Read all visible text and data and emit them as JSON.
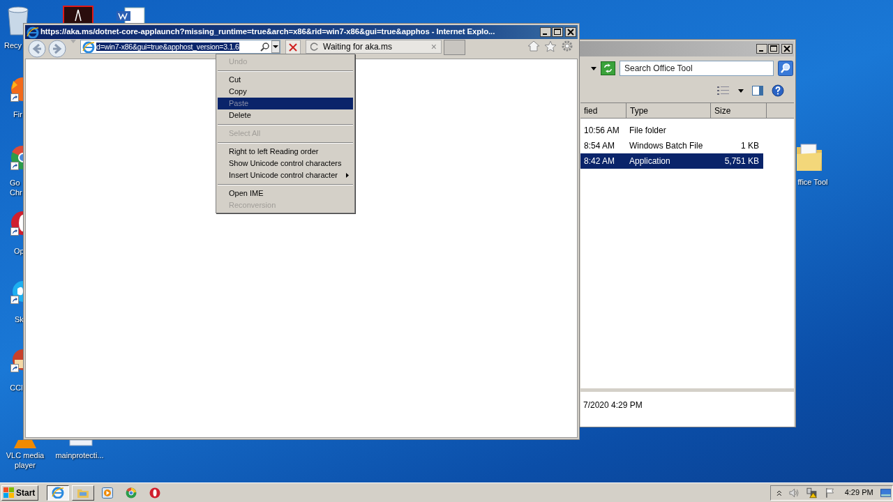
{
  "desktop_icons": [
    {
      "label": "Recy"
    },
    {
      "label": "Fir"
    },
    {
      "label": "Go Chr"
    },
    {
      "label": "Op"
    },
    {
      "label": "Sk"
    },
    {
      "label": "CCl"
    },
    {
      "label": "VLC media player"
    },
    {
      "label": "mainprotecti..."
    },
    {
      "label": "ffice Tool"
    }
  ],
  "browser": {
    "title": "https://aka.ms/dotnet-core-applaunch?missing_runtime=true&arch=x86&rid=win7-x86&gui=true&apphos - Internet Explo...",
    "address": "d=win7-x86&gui=true&apphost_version=3.1.6",
    "tab": {
      "label": "Waiting for aka.ms",
      "close": "×"
    }
  },
  "context_menu": {
    "items": [
      {
        "kind": "item",
        "label": "Undo",
        "disabled": true,
        "selected": false,
        "submenu": false
      },
      {
        "kind": "separator"
      },
      {
        "kind": "item",
        "label": "Cut",
        "disabled": false,
        "selected": false,
        "submenu": false
      },
      {
        "kind": "item",
        "label": "Copy",
        "disabled": false,
        "selected": false,
        "submenu": false
      },
      {
        "kind": "item",
        "label": "Paste",
        "disabled": true,
        "selected": true,
        "submenu": false
      },
      {
        "kind": "item",
        "label": "Delete",
        "disabled": false,
        "selected": false,
        "submenu": false
      },
      {
        "kind": "separator"
      },
      {
        "kind": "item",
        "label": "Select All",
        "disabled": true,
        "selected": false,
        "submenu": false
      },
      {
        "kind": "separator"
      },
      {
        "kind": "item",
        "label": "Right to left Reading order",
        "disabled": false,
        "selected": false,
        "submenu": false
      },
      {
        "kind": "item",
        "label": "Show Unicode control characters",
        "disabled": false,
        "selected": false,
        "submenu": false
      },
      {
        "kind": "item",
        "label": "Insert Unicode control character",
        "disabled": false,
        "selected": false,
        "submenu": true
      },
      {
        "kind": "separator"
      },
      {
        "kind": "item",
        "label": "Open IME",
        "disabled": false,
        "selected": false,
        "submenu": false
      },
      {
        "kind": "item",
        "label": "Reconversion",
        "disabled": true,
        "selected": false,
        "submenu": false
      }
    ]
  },
  "explorer": {
    "search": {
      "placeholder": "Search Office Tool"
    },
    "columns": [
      "fied",
      "Type",
      "Size"
    ],
    "rows": [
      {
        "modified": "10:56 AM",
        "type": "File folder",
        "selected": false
      },
      {
        "modified": "8:54 AM",
        "type": "Windows Batch File",
        "size": "1 KB",
        "selected": false
      },
      {
        "modified": "8:42 AM",
        "type": "Application",
        "size": "5,751 KB",
        "selected": true
      }
    ],
    "details": "7/2020 4:29 PM"
  },
  "taskbar": {
    "start": "Start",
    "items": [
      {
        "kind": "window",
        "selected": true
      },
      {
        "kind": "window",
        "selected": false
      },
      {
        "kind": "pinned",
        "selected": false
      },
      {
        "kind": "pinned",
        "selected": false
      },
      {
        "kind": "pinned",
        "selected": false
      }
    ],
    "clock": "4:29 PM"
  }
}
